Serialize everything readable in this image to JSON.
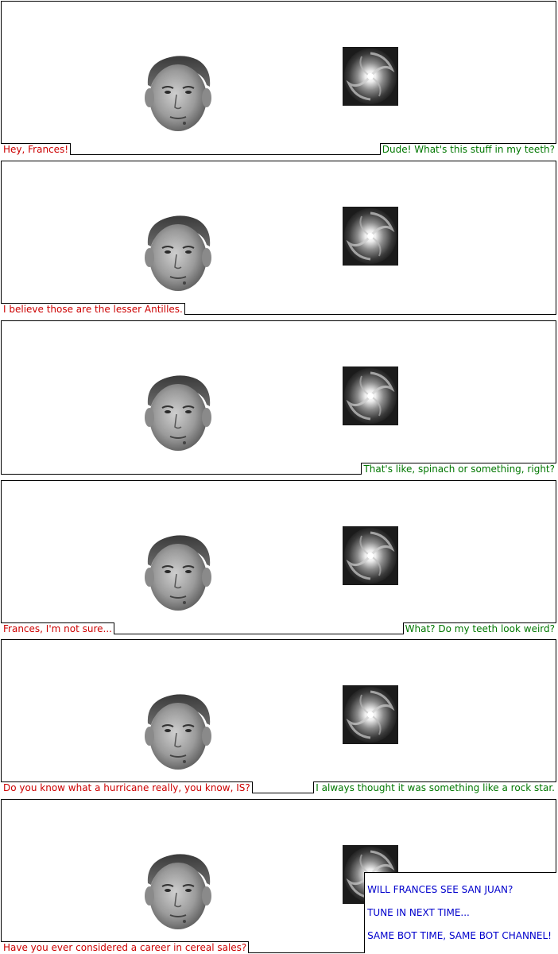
{
  "colors": {
    "mao_text": "#cc0000",
    "frances_text": "#007700",
    "announcer_text": "#0000cc",
    "border": "#000000"
  },
  "panels": [
    {
      "left_caption": "Hey, Frances!",
      "right_caption": "Dude!  What's this stuff in my teeth?"
    },
    {
      "left_caption": "I believe those are the lesser Antilles."
    },
    {
      "right_caption": "That's like, spinach or something, right?"
    },
    {
      "left_caption": "Frances, I'm not sure...",
      "right_caption": "What?  Do my teeth look weird?"
    },
    {
      "left_caption": "Do you know what a hurricane really, you know, IS?",
      "right_caption": "I always thought it was something like a rock star."
    },
    {
      "left_caption": "Have you ever considered a career in cereal sales?",
      "announcer_lines": [
        "WILL FRANCES SEE SAN JUAN?",
        "TUNE IN NEXT TIME...",
        "SAME BOT TIME, SAME BOT CHANNEL!"
      ]
    }
  ]
}
